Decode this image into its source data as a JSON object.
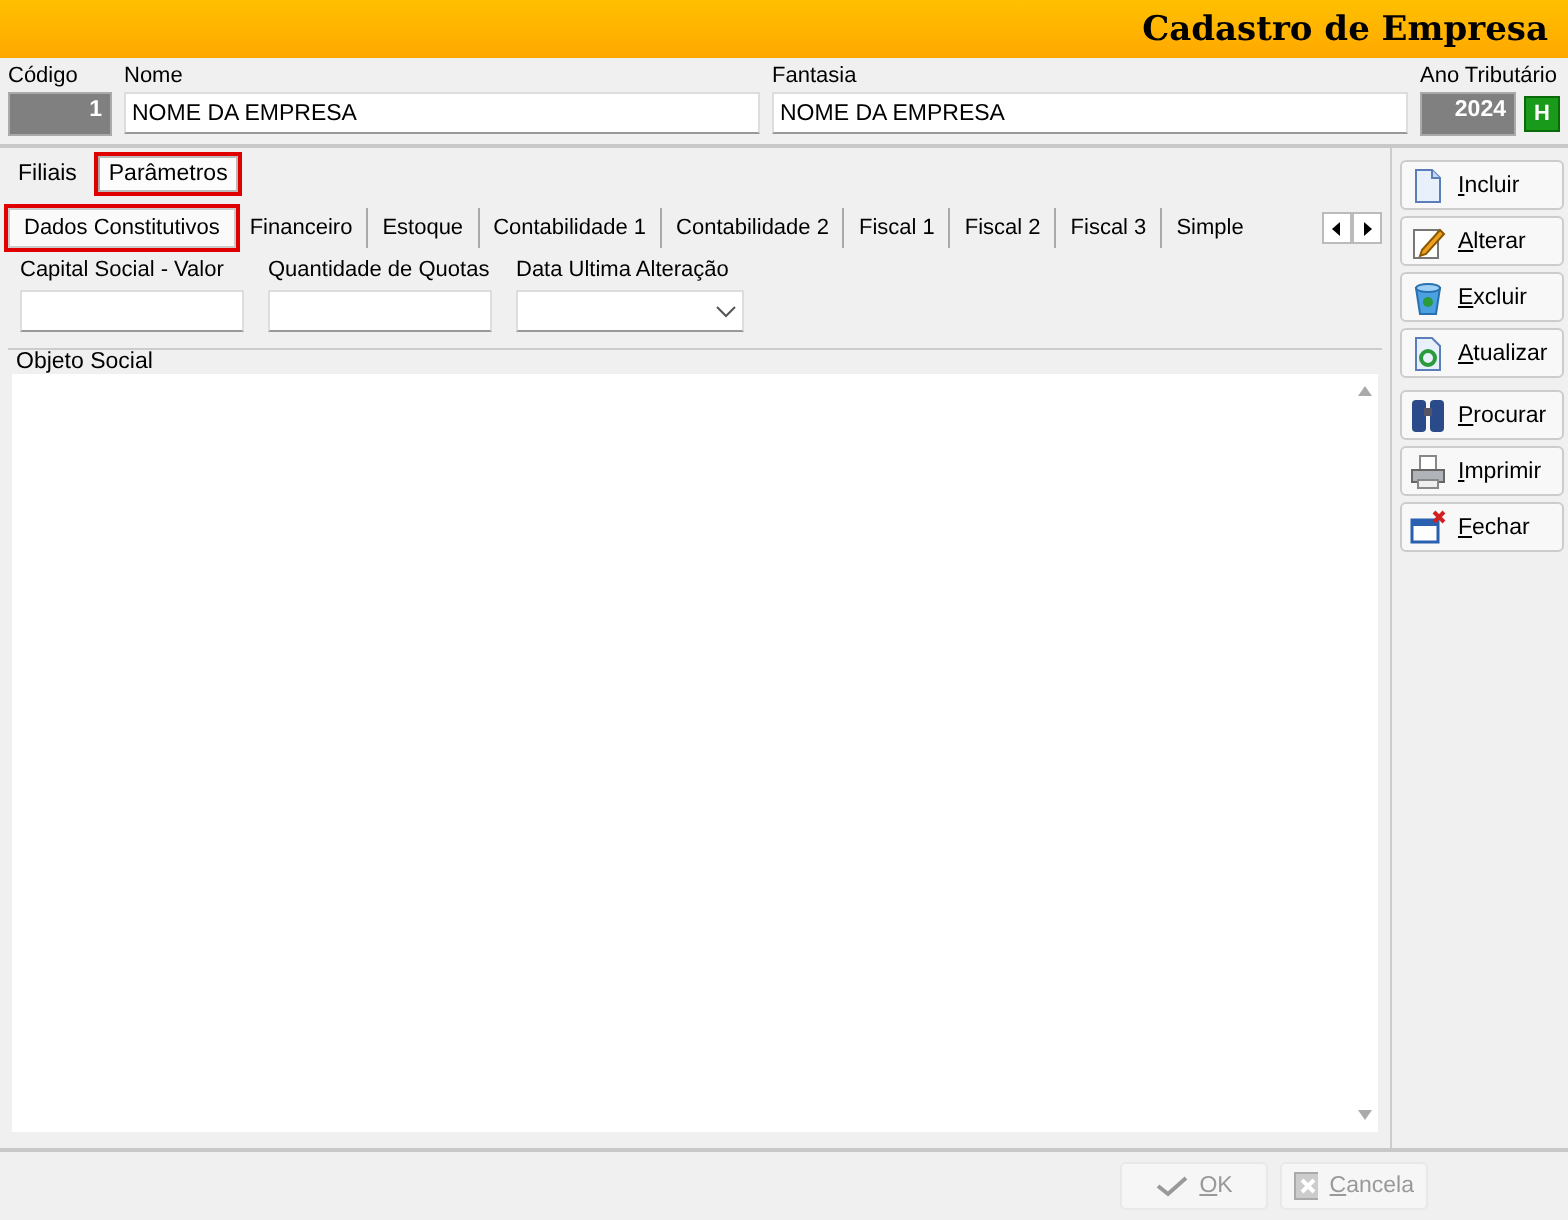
{
  "window": {
    "title": "Cadastro de Empresa"
  },
  "header_fields": [
    {
      "label": "Código",
      "value": "1",
      "kind": "readonly"
    },
    {
      "label": "Nome",
      "value": "NOME DA EMPRESA",
      "kind": "text"
    },
    {
      "label": "Fantasia",
      "value": "NOME DA EMPRESA",
      "kind": "text"
    }
  ],
  "ano_tributario": {
    "label": "Ano Tributário",
    "value": "2024",
    "button": "H"
  },
  "outer_tabs": [
    {
      "label": "Filiais",
      "selected": false,
      "highlighted": false
    },
    {
      "label": "Parâmetros",
      "selected": true,
      "highlighted": true
    }
  ],
  "inner_tabs": [
    {
      "label": "Dados  Constitutivos",
      "selected": true,
      "highlighted": true
    },
    {
      "label": "Financeiro",
      "selected": false,
      "highlighted": false
    },
    {
      "label": "Estoque",
      "selected": false,
      "highlighted": false
    },
    {
      "label": "Contabilidade 1",
      "selected": false,
      "highlighted": false
    },
    {
      "label": "Contabilidade 2",
      "selected": false,
      "highlighted": false
    },
    {
      "label": "Fiscal 1",
      "selected": false,
      "highlighted": false
    },
    {
      "label": "Fiscal 2",
      "selected": false,
      "highlighted": false
    },
    {
      "label": "Fiscal 3",
      "selected": false,
      "highlighted": false
    },
    {
      "label": "Simple",
      "selected": false,
      "highlighted": false
    }
  ],
  "form_fields": [
    {
      "label": "Capital Social - Valor",
      "kind": "text"
    },
    {
      "label": "Quantidade de Quotas",
      "kind": "text"
    },
    {
      "label": "Data Ultima Alteração",
      "kind": "dropdown"
    }
  ],
  "memo": {
    "label": "Objeto Social"
  },
  "side_buttons": [
    {
      "label": "Incluir"
    },
    {
      "label": "Alterar"
    },
    {
      "label": "Excluir"
    },
    {
      "label": "Atualizar"
    },
    {
      "label": "Procurar"
    },
    {
      "label": "Imprimir"
    },
    {
      "label": "Fechar"
    }
  ],
  "footer_buttons": [
    {
      "label": "OK",
      "disabled": true
    },
    {
      "label": "Cancela",
      "disabled": true
    }
  ]
}
